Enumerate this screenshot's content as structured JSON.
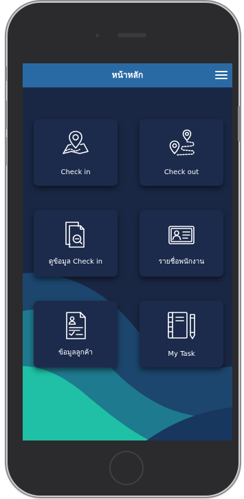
{
  "header": {
    "title": "หน้าหลัก",
    "menu_icon": "hamburger-menu-icon"
  },
  "tiles": [
    {
      "label": "Check in",
      "icon": "map-location-icon"
    },
    {
      "label": "Check out",
      "icon": "route-path-icon"
    },
    {
      "label": "ดูข้อมูล Check in",
      "icon": "document-search-icon"
    },
    {
      "label": "รายชื่อพนักงาน",
      "icon": "id-card-icon"
    },
    {
      "label": "ข้อมูลลูกค้า",
      "icon": "customer-document-icon"
    },
    {
      "label": "My Task",
      "icon": "notebook-pencil-icon"
    }
  ],
  "colors": {
    "header": "#2a6aa4",
    "screen_bg": "#1a2744",
    "tile_bg": "#1c2b4b",
    "accent_wave": "#1fc0a5"
  }
}
